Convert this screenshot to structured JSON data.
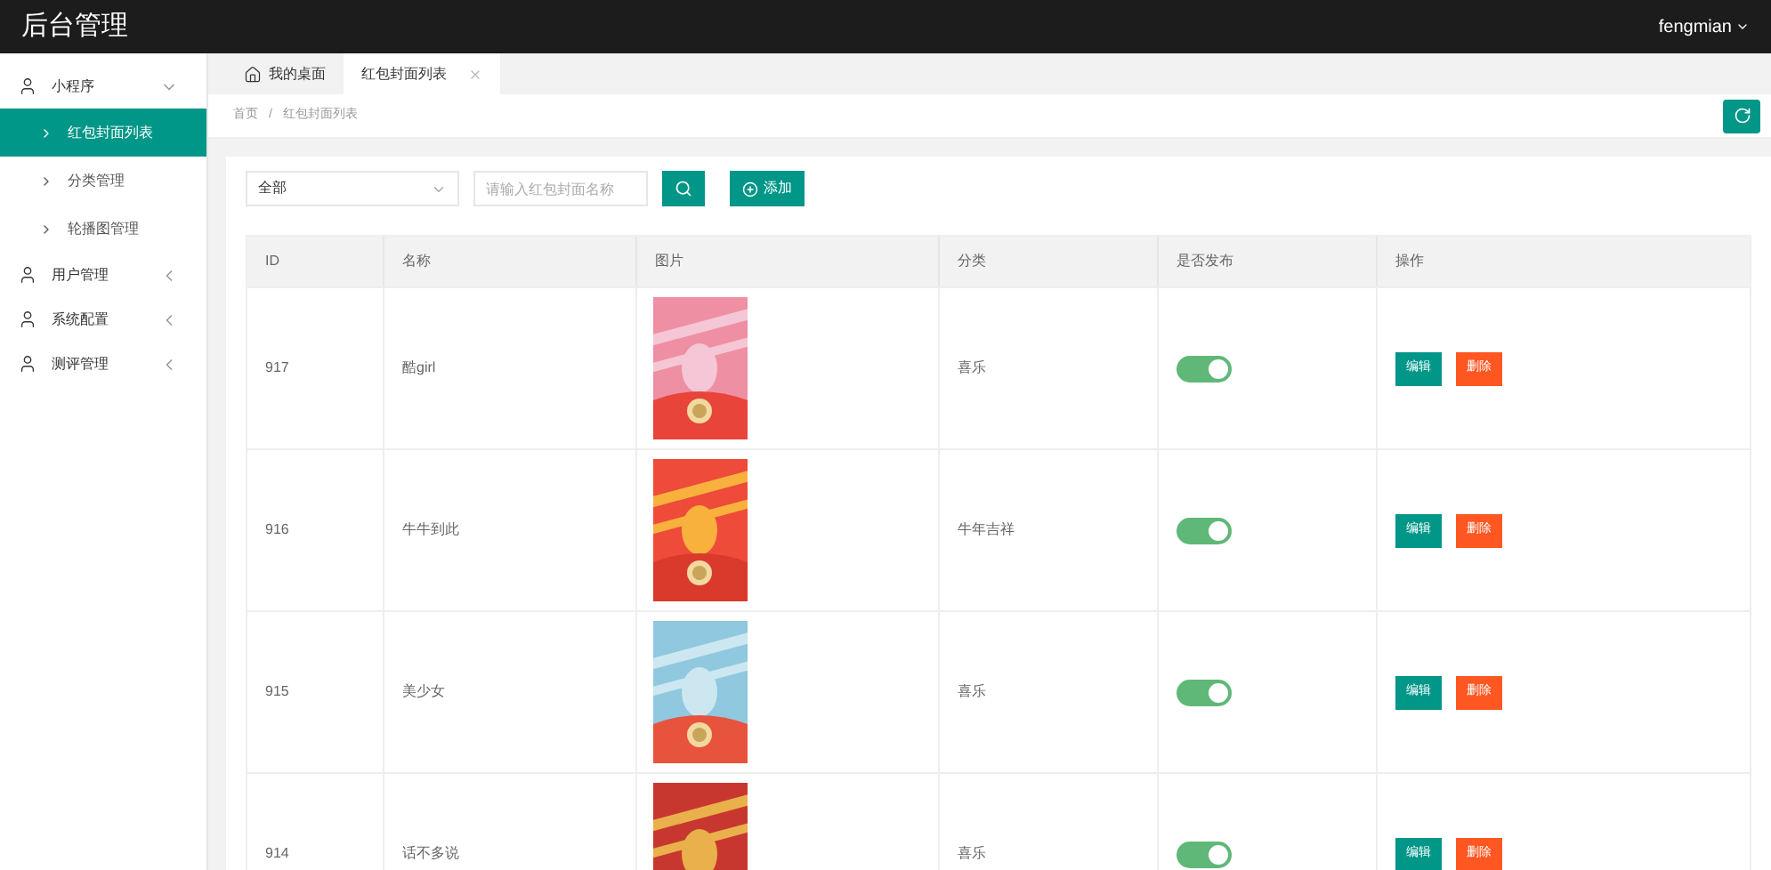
{
  "header": {
    "title": "后台管理",
    "user": "fengmian"
  },
  "sidebar": {
    "items": [
      {
        "label": "小程序",
        "expanded": true,
        "children": [
          {
            "label": "红包封面列表",
            "selected": true
          },
          {
            "label": "分类管理",
            "selected": false
          },
          {
            "label": "轮播图管理",
            "selected": false
          }
        ]
      },
      {
        "label": "用户管理",
        "expanded": false
      },
      {
        "label": "系统配置",
        "expanded": false
      },
      {
        "label": "测评管理",
        "expanded": false
      }
    ]
  },
  "tabs": [
    {
      "label": "我的桌面",
      "kind": "home",
      "selected": false
    },
    {
      "label": "红包封面列表",
      "kind": "closable",
      "selected": true
    }
  ],
  "breadcrumb": {
    "separator": "/",
    "items": [
      "首页",
      "红包封面列表"
    ]
  },
  "filter": {
    "select": "全部",
    "search_placeholder": "请输入红包封面名称",
    "add_button": "添加"
  },
  "table": {
    "columns": [
      "ID",
      "名称",
      "图片",
      "分类",
      "是否发布",
      "操作"
    ],
    "rows": [
      {
        "id": "917",
        "name": "酷girl",
        "category": "喜乐",
        "published": true,
        "edit": "编辑",
        "delete": "删除"
      },
      {
        "id": "916",
        "name": "牛牛到此",
        "category": "牛年吉祥",
        "published": true,
        "edit": "编辑",
        "delete": "删除"
      },
      {
        "id": "915",
        "name": "美少女",
        "category": "喜乐",
        "published": true,
        "edit": "编辑",
        "delete": "删除"
      },
      {
        "id": "914",
        "name": "话不多说",
        "category": "喜乐",
        "published": true,
        "edit": "编辑",
        "delete": "删除"
      }
    ]
  }
}
